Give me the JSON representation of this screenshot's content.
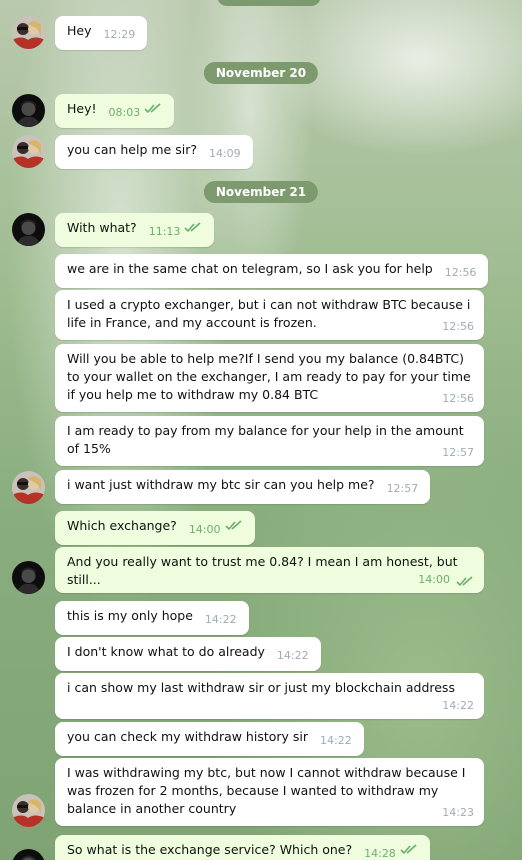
{
  "date_separators": [
    "November 20",
    "November 21"
  ],
  "messages": [
    {
      "text": "Hey",
      "time": "12:29"
    },
    {
      "text": "Hey!",
      "time": "08:03"
    },
    {
      "text": "you can help me sir?",
      "time": "14:09"
    },
    {
      "text": "With what?",
      "time": "11:13"
    },
    {
      "text": "we are in the same chat on telegram, so I ask you for help",
      "time": "12:56"
    },
    {
      "text": "I used a crypto exchanger, but i can not withdraw BTC because i life in France, and my account is frozen.",
      "time": "12:56"
    },
    {
      "text": "Will you be able to help me?If I send you my balance (0.84BTC) to your wallet on the exchanger, I am ready to pay for your time if you help me to withdraw my 0.84 BTC",
      "time": "12:56"
    },
    {
      "text": "I am ready to pay from my balance for your help in the amount of 15%",
      "time": "12:57"
    },
    {
      "text": "i want just withdraw my btc sir can you help me?",
      "time": "12:57"
    },
    {
      "text": "Which exchange?",
      "time": "14:00"
    },
    {
      "text": "And you really want to trust me 0.84? I mean I am honest, but still...",
      "time": "14:00"
    },
    {
      "text": "this is my only hope",
      "time": "14:22"
    },
    {
      "text": "I don't know what to do already",
      "time": "14:22"
    },
    {
      "text": "i can show my last withdraw sir or just my blockchain address",
      "time": "14:22"
    },
    {
      "text": "you can check my withdraw history sir",
      "time": "14:22"
    },
    {
      "text": "I was withdrawing my btc, but now I cannot withdraw because I was frozen for 2 months, because I wanted to withdraw my balance in another country",
      "time": "14:23"
    },
    {
      "text": "So what is the exchange service? Which one?",
      "time": "14:28"
    }
  ],
  "icons": {
    "read_receipt": "double-check-icon",
    "avatar_other": "avatar-couple",
    "avatar_self": "avatar-dark"
  },
  "colors": {
    "outgoing_bubble": "#effdde",
    "incoming_bubble": "#ffffff",
    "date_pill": "#7d9a6e",
    "tick": "#6ab06b"
  }
}
